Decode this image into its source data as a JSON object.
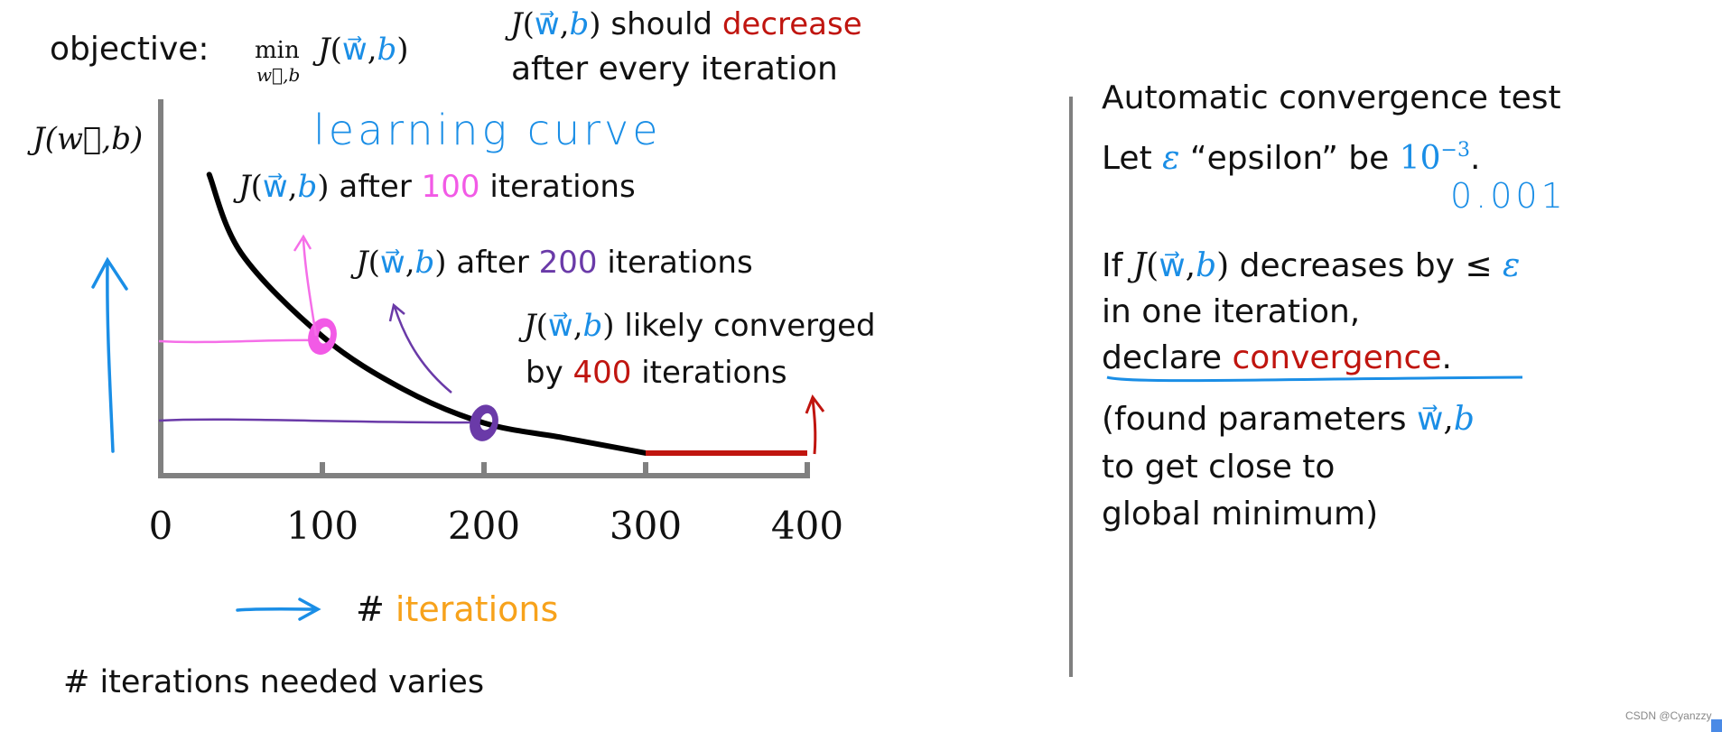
{
  "header": {
    "objective_label": "objective:",
    "min_op": "min",
    "min_sub": "w⃗,b",
    "J": "J",
    "open": "(",
    "w": "w⃗",
    "comma": ",",
    "b": "b",
    "close": ")",
    "should": " should ",
    "decrease": "decrease",
    "line2": "after every iteration"
  },
  "chart_data": {
    "type": "line",
    "title": "learning curve",
    "xlabel_prefix": "# ",
    "xlabel": "iterations",
    "ylabel": "J(w⃗,b)",
    "xlim": [
      0,
      400
    ],
    "x_ticks": [
      "0",
      "100",
      "200",
      "300",
      "400"
    ],
    "y_ticks": [],
    "grid": false,
    "series": [
      {
        "x": [
          30,
          50,
          100,
          150,
          200,
          250,
          300,
          400
        ],
        "y": [
          0.8,
          0.59,
          0.37,
          0.23,
          0.14,
          0.1,
          0.06,
          0.06
        ],
        "color": "#000000",
        "converged_from": 300,
        "converged_color": "#c0150f"
      }
    ],
    "markers": [
      {
        "x": 100,
        "y": 0.37,
        "color": "#f25ae6"
      },
      {
        "x": 200,
        "y": 0.14,
        "color": "#6a3aa8"
      }
    ],
    "annotations": {
      "a100_pre": " after ",
      "a100_num": "100",
      "a100_post": " iterations",
      "a200_pre": " after ",
      "a200_num": "200",
      "a200_post": " iterations",
      "conv_pre": " likely converged",
      "conv_by": "by ",
      "conv_num": "400",
      "conv_post": " iterations"
    }
  },
  "footer_note": "# iterations needed varies",
  "right_panel": {
    "title": "Automatic convergence test",
    "let": "Let ",
    "epsilon": "ε",
    "epsilon_word": "  “epsilon” be ",
    "ten": "10",
    "exp": "−3",
    "period": ".",
    "handwritten_value": "0.001",
    "if": "If ",
    "decreases": " decreases by ≤ ",
    "line_one_iter": "in one iteration,",
    "declare": "declare ",
    "convergence": "convergence",
    "found": "(found parameters ",
    "close_line": "to get close to",
    "global": "global minimum)"
  },
  "watermark": "CSDN @Cyanzzy",
  "colors": {
    "blue": "#1a8ee6",
    "red": "#c0150f",
    "pink": "#f25ae6",
    "purple": "#6a3aa8",
    "orange": "#f7a21b",
    "axis": "#808080"
  }
}
